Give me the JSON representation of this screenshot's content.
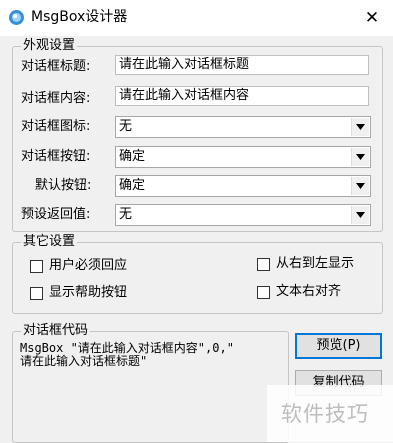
{
  "window": {
    "title": "MsgBox设计器",
    "close_label": "✕"
  },
  "appearance": {
    "legend": "外观设置",
    "title_label": "对话框标题:",
    "title_value": "请在此输入对话框标题",
    "content_label": "对话框内容:",
    "content_value": "请在此输入对话框内容",
    "icon_label": "对话框图标:",
    "icon_value": "无",
    "buttons_label": "对话框按钮:",
    "buttons_value": "确定",
    "default_label": "默认按钮:",
    "default_value": "确定",
    "return_label": "预设返回值:",
    "return_value": "无"
  },
  "other": {
    "legend": "其它设置",
    "user_must_reply": "用户必须回应",
    "show_help": "显示帮助按钮",
    "rtl": "从右到左显示",
    "text_right": "文本右对齐"
  },
  "code_section": {
    "legend": "对话框代码",
    "line1": "MsgBox \"请在此输入对话框内容\",0,\"",
    "line2": "请在此输入对话框标题\"",
    "preview_button": "预览(P)",
    "copy_button": "复制代码"
  },
  "watermark": "软件技巧"
}
